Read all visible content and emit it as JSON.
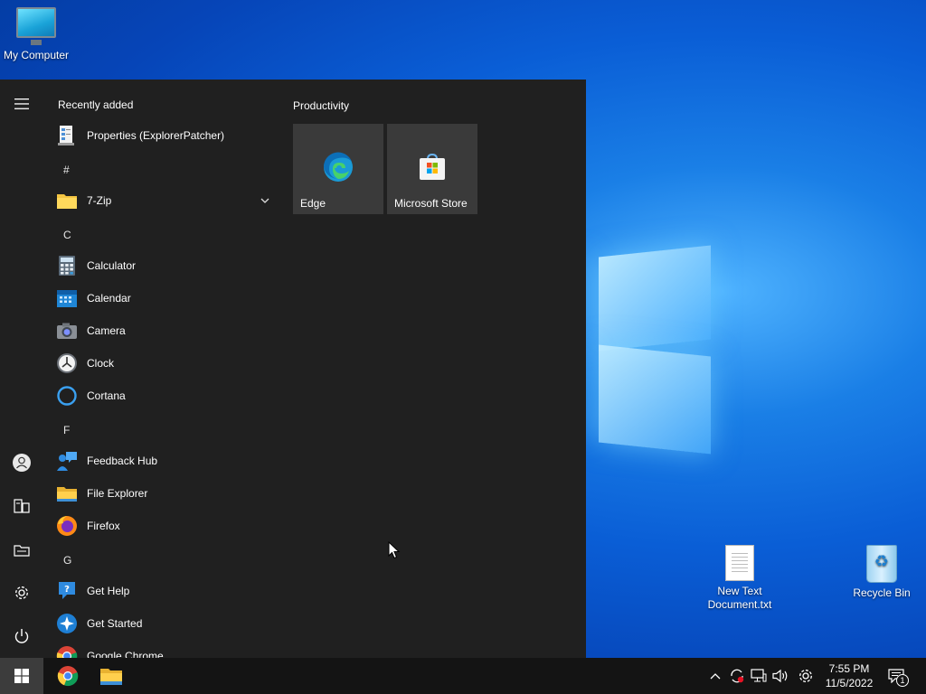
{
  "desktop": {
    "icons": [
      {
        "label": "My Computer",
        "icon": "monitor-icon"
      },
      {
        "label": "New Text Document.txt",
        "line1": "New Text",
        "line2": "Document.txt",
        "icon": "text-document-icon"
      },
      {
        "label": "Recycle Bin",
        "icon": "recycle-bin-icon"
      }
    ]
  },
  "start_menu": {
    "rail": [
      {
        "name": "hamburger-menu-icon",
        "label": "Expand"
      },
      {
        "name": "user-avatar-icon",
        "label": "User"
      },
      {
        "name": "documents-icon",
        "label": "Documents"
      },
      {
        "name": "pictures-icon",
        "label": "Pictures"
      },
      {
        "name": "settings-gear-icon",
        "label": "Settings"
      },
      {
        "name": "power-icon",
        "label": "Power"
      }
    ],
    "recently_added_title": "Recently added",
    "groups": {
      "hash": "#",
      "c": "C",
      "f": "F",
      "g": "G"
    },
    "apps": {
      "properties": "Properties (ExplorerPatcher)",
      "zip": "7-Zip",
      "calculator": "Calculator",
      "calendar": "Calendar",
      "camera": "Camera",
      "clock": "Clock",
      "cortana": "Cortana",
      "feedback": "Feedback Hub",
      "explorer": "File Explorer",
      "firefox": "Firefox",
      "gethelp": "Get Help",
      "getstarted": "Get Started",
      "chrome": "Google Chrome"
    },
    "tiles_group": "Productivity",
    "tiles": [
      {
        "label": "Edge",
        "icon": "edge-icon"
      },
      {
        "label": "Microsoft Store",
        "icon": "store-icon"
      }
    ]
  },
  "taskbar": {
    "pinned": [
      {
        "name": "chrome",
        "icon": "chrome-icon"
      },
      {
        "name": "file-explorer",
        "icon": "folder-icon"
      }
    ],
    "tray": [
      "chevron-up-icon",
      "sync-icon",
      "network-icon",
      "volume-icon",
      "gear-icon"
    ],
    "time": "7:55 PM",
    "date": "11/5/2022",
    "notifications_count": "1"
  },
  "colors": {
    "menu_bg": "#202020",
    "tile_bg": "#3a3a3a",
    "taskbar_bg": "#141414",
    "accent": "#0078d7"
  }
}
